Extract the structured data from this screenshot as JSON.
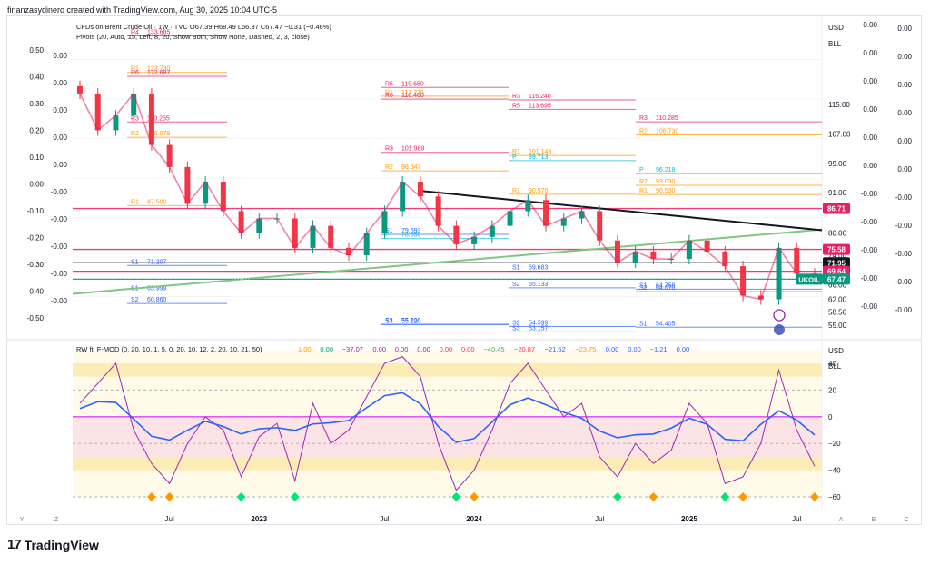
{
  "header": {
    "text": "finanzasydinero created with TradingView.com, Aug 30, 2025 10:04 UTC-5"
  },
  "brand": {
    "logo": "17",
    "name": "TradingView"
  },
  "colors": {
    "bull": "#089981",
    "bear": "#f23645",
    "pivot_red": "#e91e63",
    "trend_black": "#131722",
    "trend_green": "#81c784",
    "zigzag_pink": "#e91e63",
    "price_label": "#089981",
    "osc_blue": "#2962ff",
    "osc_magenta": "#9c27b0",
    "band_yellow": "#f9e79f",
    "band_pink": "#fbe3e6"
  },
  "main_pane": {
    "legend": {
      "line1": "CFDs on Brent Crude Oil · 1W · TVC  O67.39  H68.49  L66.37  C67.47  −0.31 (−0.46%)",
      "line2": "Pivots (20, Auto, 15, Left, 8, 20, Show Both, Show None, Dashed, 2, 3, close)"
    },
    "currency": "USD",
    "unit": "BLL",
    "price_axis_ticks": [
      "115.00",
      "107.00",
      "99.00",
      "91.00",
      "80.00",
      "74.00",
      "66.00",
      "62.00",
      "58.50",
      "55.00"
    ],
    "price_tags": [
      {
        "value": "86.71",
        "color": "#e91e63"
      },
      {
        "value": "75.58",
        "color": "#e91e63"
      },
      {
        "value": "71.95",
        "color": "#131722"
      },
      {
        "value": "69.64",
        "color": "#e91e63"
      },
      {
        "value": "67.47",
        "color": "#089981"
      }
    ],
    "symbol_tag": "UKOIL",
    "left_scale_ticks": [
      "0.50",
      "0.40",
      "0.30",
      "0.20",
      "0.10",
      "0.00",
      "-0.10",
      "-0.20",
      "-0.30",
      "-0.40",
      "-0.50"
    ],
    "left_scale_ticks_2": [
      "0.00",
      "0.00",
      "0.00",
      "0.00",
      "0.00",
      "-0.00",
      "-0.00",
      "-0.00",
      "-0.00",
      "-0.00"
    ],
    "right_scale_ticks_1": [
      "0.00",
      "0.00",
      "0.00",
      "0.00",
      "0.00",
      "0.00",
      "-0.00",
      "-0.00",
      "-0.00",
      "-0.00",
      "-0.00"
    ],
    "right_scale_ticks_2": [
      "0.00",
      "0.00",
      "0.00",
      "0.00",
      "0.00",
      "0.00",
      "-0.00",
      "-0.00",
      "-0.00",
      "-0.00",
      "-0.00"
    ],
    "pivot_labels": [
      {
        "label": "R1",
        "value": "123.730"
      },
      {
        "label": "R1",
        "value": "117.275"
      },
      {
        "label": "P",
        "value": "99.713"
      },
      {
        "label": "P",
        "value": "96.218"
      },
      {
        "label": "R6",
        "value": "122.687"
      },
      {
        "label": "R5",
        "value": "119.650"
      },
      {
        "label": "R3",
        "value": "116.240"
      },
      {
        "label": "R2",
        "value": "106.730"
      },
      {
        "label": "R2",
        "value": "106.079"
      },
      {
        "label": "R2",
        "value": "96.947"
      },
      {
        "label": "R1",
        "value": "90.570"
      },
      {
        "label": "R1",
        "value": "90.530"
      },
      {
        "label": "S1",
        "value": "71.207"
      },
      {
        "label": "S1",
        "value": "79.693"
      },
      {
        "label": "S2",
        "value": "65.133"
      },
      {
        "label": "S1",
        "value": "64.758"
      },
      {
        "label": "S2",
        "value": "60.860"
      },
      {
        "label": "S3",
        "value": "55.200"
      },
      {
        "label": "S2",
        "value": "54.599"
      },
      {
        "label": "S1",
        "value": "54.405"
      },
      {
        "label": "R4",
        "value": "133.685"
      },
      {
        "label": "R6",
        "value": "116.460"
      },
      {
        "label": "R5",
        "value": "113.695"
      },
      {
        "label": "R3",
        "value": "110.285"
      },
      {
        "label": "R3",
        "value": "110.255"
      },
      {
        "label": "R3",
        "value": "101.989"
      },
      {
        "label": "R1",
        "value": "101.148"
      },
      {
        "label": "R2",
        "value": "93.030"
      },
      {
        "label": "R1",
        "value": "87.500"
      },
      {
        "label": "P",
        "value": "78.550"
      },
      {
        "label": "S1",
        "value": "69.683"
      },
      {
        "label": "S2",
        "value": "64.070"
      },
      {
        "label": "S1",
        "value": "63.999"
      },
      {
        "label": "S3",
        "value": "55.120"
      },
      {
        "label": "S3",
        "value": "53.157"
      }
    ]
  },
  "osc_pane": {
    "legend": {
      "name": "RW ft. F-MOD (0, 20, 10, 1, 5, 0, 20, 10, 12, 2, 20, 10, 21, 50)",
      "values": [
        {
          "v": "1.00",
          "c": "#ff9800"
        },
        {
          "v": "0.00",
          "c": "#089981"
        },
        {
          "v": "−37.07",
          "c": "#9c27b0"
        },
        {
          "v": "0.00",
          "c": "#9c27b0"
        },
        {
          "v": "0.00",
          "c": "#9c27b0"
        },
        {
          "v": "0.00",
          "c": "#9c27b0"
        },
        {
          "v": "0.00",
          "c": "#f23645"
        },
        {
          "v": "0.00",
          "c": "#f23645"
        },
        {
          "v": "−40.45",
          "c": "#4caf50"
        },
        {
          "v": "−20.87",
          "c": "#f23645"
        },
        {
          "v": "−21.62",
          "c": "#2962ff"
        },
        {
          "v": "−23.75",
          "c": "#ff9800"
        },
        {
          "v": "0.00",
          "c": "#2962ff"
        },
        {
          "v": "0.00",
          "c": "#2962ff"
        },
        {
          "v": "−1.21",
          "c": "#2962ff"
        },
        {
          "v": "0.00",
          "c": "#2962ff"
        }
      ]
    },
    "currency": "USD",
    "unit": "BLL",
    "axis_ticks": [
      "40",
      "20",
      "0",
      "−20",
      "−40",
      "−60"
    ]
  },
  "time_axis": {
    "labels": [
      "Jul",
      "2023",
      "Jul",
      "2024",
      "Jul",
      "2025",
      "Jul"
    ],
    "left_glyphs": [
      "Y",
      "Z"
    ],
    "right_glyphs": [
      "A",
      "B",
      "C"
    ]
  },
  "chart_data": {
    "type": "line",
    "title": "CFDs on Brent Crude Oil · 1W · TVC",
    "x": [
      "2022-03",
      "2022-04",
      "2022-05",
      "2022-06",
      "2022-07",
      "2022-08",
      "2022-09",
      "2022-10",
      "2022-11",
      "2022-12",
      "2023-01",
      "2023-02",
      "2023-03",
      "2023-04",
      "2023-05",
      "2023-06",
      "2023-07",
      "2023-08",
      "2023-09",
      "2023-10",
      "2023-11",
      "2023-12",
      "2024-01",
      "2024-02",
      "2024-03",
      "2024-04",
      "2024-05",
      "2024-06",
      "2024-07",
      "2024-08",
      "2024-09",
      "2024-10",
      "2024-11",
      "2024-12",
      "2025-01",
      "2025-02",
      "2025-03",
      "2025-04",
      "2025-05",
      "2025-06",
      "2025-07",
      "2025-08"
    ],
    "series": [
      {
        "name": "Brent close",
        "values": [
          118,
          108,
          112,
          118,
          104,
          98,
          88,
          94,
          86,
          80,
          84,
          84,
          76,
          82,
          76,
          74,
          80,
          86,
          94,
          90,
          82,
          77,
          79,
          82,
          86,
          89,
          82,
          84,
          86,
          78,
          72,
          75,
          73,
          73,
          78,
          75,
          71,
          63,
          62,
          76,
          69,
          67.47
        ]
      }
    ],
    "osc_series": [
      {
        "name": "RW ft. F-MOD",
        "values": [
          10,
          25,
          40,
          -10,
          -35,
          -50,
          -20,
          0,
          -10,
          -45,
          -15,
          -5,
          -48,
          10,
          -20,
          -10,
          15,
          40,
          45,
          30,
          -20,
          -55,
          -40,
          -10,
          25,
          40,
          20,
          0,
          10,
          -30,
          -45,
          -20,
          -35,
          -25,
          10,
          -5,
          -50,
          -45,
          -20,
          35,
          -10,
          -37.07
        ]
      }
    ],
    "ylabel": "USD",
    "ylim": [
      52,
      138
    ]
  }
}
